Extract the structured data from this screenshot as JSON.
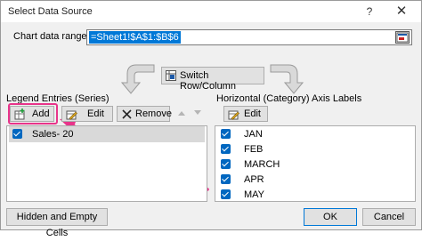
{
  "window": {
    "title": "Select Data Source",
    "help_glyph": "?",
    "close_glyph": "✕"
  },
  "range": {
    "label": "Chart data range:",
    "value": "=Sheet1!$A$1:$B$6"
  },
  "switch_button": {
    "label": "Switch Row/Column",
    "icon": "switch-row-column-icon"
  },
  "legend": {
    "title": "Legend Entries (Series)",
    "add_label": "Add",
    "edit_label": "Edit",
    "remove_label": "Remove",
    "series": [
      {
        "label": "Sales- 20",
        "checked": true,
        "selected": true
      }
    ]
  },
  "axis": {
    "title": "Horizontal (Category) Axis Labels",
    "edit_label": "Edit",
    "items": [
      {
        "label": "JAN",
        "checked": true
      },
      {
        "label": "FEB",
        "checked": true
      },
      {
        "label": "MARCH",
        "checked": true
      },
      {
        "label": "APR",
        "checked": true
      },
      {
        "label": "MAY",
        "checked": true
      }
    ]
  },
  "footer": {
    "hidden_cells_label": "Hidden and Empty Cells",
    "ok_label": "OK",
    "cancel_label": "Cancel"
  },
  "colors": {
    "accent": "#0078d7",
    "checkbox": "#0067c0",
    "annotation": "#e8348a"
  }
}
